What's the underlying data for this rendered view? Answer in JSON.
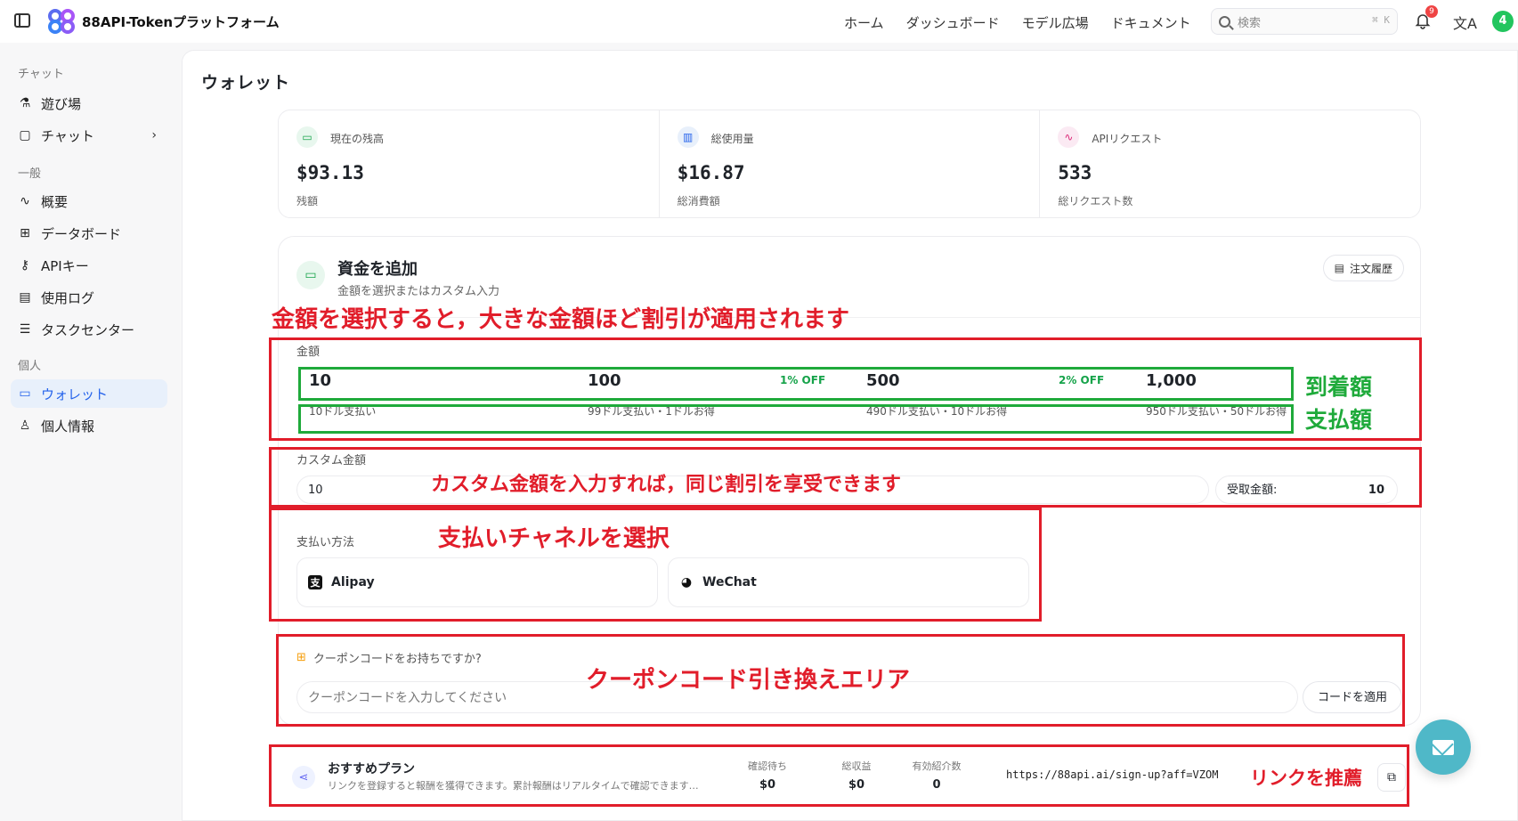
{
  "header": {
    "app_title": "88API-Tokenプラットフォーム",
    "nav": [
      "ホーム",
      "ダッシュボード",
      "モデル広場",
      "ドキュメント"
    ],
    "search_placeholder": "検索",
    "search_shortcut": "⌘ K",
    "notification_count": "9",
    "avatar_letter": "4"
  },
  "sidebar": {
    "groups": {
      "chat": "チャット",
      "general": "一般",
      "personal": "個人"
    },
    "items": {
      "playground": "遊び場",
      "chat": "チャット",
      "overview": "概要",
      "databoard": "データボード",
      "api_keys": "APIキー",
      "usage_log": "使用ログ",
      "task_center": "タスクセンター",
      "wallet": "ウォレット",
      "profile": "個人情報"
    }
  },
  "page": {
    "title": "ウォレット"
  },
  "stats": [
    {
      "label": "現在の残高",
      "value": "$93.13",
      "sub": "残額"
    },
    {
      "label": "総使用量",
      "value": "$16.87",
      "sub": "総消費額"
    },
    {
      "label": "APIリクエスト",
      "value": "533",
      "sub": "総リクエスト数"
    }
  ],
  "topup": {
    "title": "資金を追加",
    "subtitle": "金額を選択またはカスタム入力",
    "history_button": "注文履歴",
    "amount_label": "金額",
    "amounts": [
      {
        "value": "10",
        "off": "",
        "pay": "10ドル支払い"
      },
      {
        "value": "100",
        "off": "1% OFF",
        "pay": "99ドル支払い・1ドルお得"
      },
      {
        "value": "500",
        "off": "2% OFF",
        "pay": "490ドル支払い・10ドルお得"
      },
      {
        "value": "1,000",
        "off": "",
        "pay": "950ドル支払い・50ドルお得"
      }
    ],
    "custom_label": "カスタム金額",
    "custom_value": "10",
    "receive_label": "受取金額:",
    "receive_value": "10",
    "payment_label": "支払い方法",
    "payment_methods": [
      "Alipay",
      "WeChat"
    ],
    "coupon_label": "クーポンコードをお持ちですか?",
    "coupon_placeholder": "クーポンコードを入力してください",
    "coupon_button": "コードを適用"
  },
  "referral": {
    "title": "おすすめプラン",
    "subtitle": "リンクを登録すると報酬を獲得できます。累計報酬はリアルタイムで確認できます…",
    "pending_label": "確認待ち",
    "pending_value": "$0",
    "total_label": "総収益",
    "total_value": "$0",
    "valid_label": "有効紹介数",
    "valid_value": "0",
    "link": "https://88api.ai/sign-up?aff=VZOM"
  },
  "annotations": {
    "amount_note": "金額を選択すると，大きな金額ほど割引が適用されます",
    "arrival": "到着額",
    "payment": "支払額",
    "custom_note": "カスタム金額を入力すれば，同じ割引を享受できます",
    "channel_note": "支払いチャネルを選択",
    "coupon_note": "クーポンコード引き換えエリア",
    "referral_note": "リンクを推薦"
  },
  "colors": {
    "accent": "#2563eb",
    "success": "#16a34a",
    "annotation_red": "#e11d2a",
    "annotation_green": "#1faa3b",
    "chat_fab": "#4fb8c8"
  }
}
